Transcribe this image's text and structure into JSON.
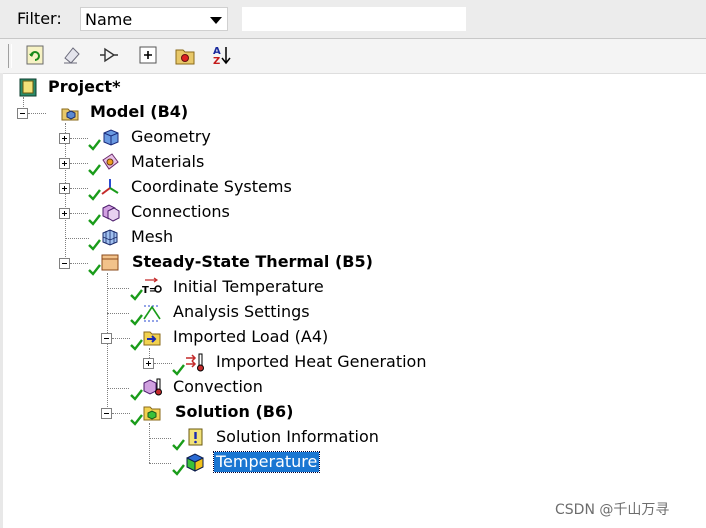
{
  "filter": {
    "label": "Filter:",
    "selected": "Name",
    "search_value": ""
  },
  "toolbar": {
    "buttons": [
      "refresh-icon",
      "suppress-icon",
      "connection-icon",
      "expand-all-icon",
      "folder-icon",
      "sort-az-icon"
    ]
  },
  "tree": {
    "project": "Project*",
    "model": "Model (B4)",
    "geometry": "Geometry",
    "materials": "Materials",
    "coordinate_systems": "Coordinate Systems",
    "connections": "Connections",
    "mesh": "Mesh",
    "analysis": "Steady-State Thermal (B5)",
    "initial_temperature": "Initial Temperature",
    "analysis_settings": "Analysis Settings",
    "imported_load": "Imported Load (A4)",
    "imported_heat_generation": "Imported Heat Generation",
    "convection": "Convection",
    "solution": "Solution (B6)",
    "solution_information": "Solution Information",
    "temperature": "Temperature"
  },
  "colors": {
    "selection": "#1976d2",
    "check": "#1a9c1a"
  },
  "watermark": "CSDN @千山万寻"
}
